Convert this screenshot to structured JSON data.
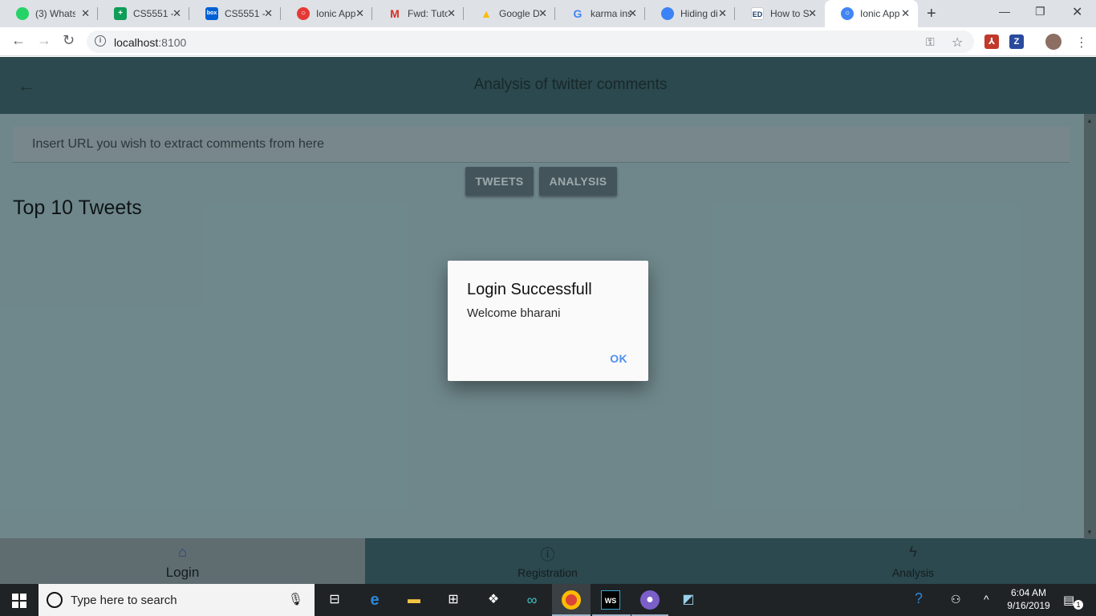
{
  "browser": {
    "tabs": [
      {
        "label": "(3) Whats",
        "icon": "whatsapp-icon",
        "color": "#25d366"
      },
      {
        "label": "CS5551 -",
        "icon": "sheets-icon",
        "color": "#0f9d58"
      },
      {
        "label": "CS5551 -",
        "icon": "box-icon",
        "color": "#0061d5"
      },
      {
        "label": "Ionic App",
        "icon": "ionic-icon",
        "color": "#e53935"
      },
      {
        "label": "Fwd: Tuto",
        "icon": "gmail-icon",
        "color": "#d93025"
      },
      {
        "label": "Google D",
        "icon": "drive-icon",
        "color": "#fbbc04"
      },
      {
        "label": "karma ins",
        "icon": "google-icon",
        "color": "#4285f4"
      },
      {
        "label": "Hiding di",
        "icon": "angular-icon",
        "color": "#3b82f6"
      },
      {
        "label": "How to S",
        "icon": "ed-icon",
        "color": "#1a3d6d"
      },
      {
        "label": "Ionic App",
        "icon": "chrome-tab-icon",
        "color": "#4285f4"
      }
    ],
    "url_host": "localhost",
    "url_port": ":8100"
  },
  "app": {
    "title": "Analysis of twitter comments",
    "url_placeholder": "Insert URL you wish to extract comments from here",
    "buttons": {
      "tweets": "TWEETS",
      "analysis": "ANALYSIS"
    },
    "section_title": "Top 10 Tweets",
    "tabbar": [
      {
        "label": "Login",
        "icon": "home-icon"
      },
      {
        "label": "Registration",
        "icon": "info-icon"
      },
      {
        "label": "Analysis",
        "icon": "flash-icon"
      }
    ]
  },
  "alert": {
    "title": "Login Successfull",
    "message": "Welcome bharani",
    "ok": "OK"
  },
  "taskbar": {
    "search_placeholder": "Type here to search",
    "time": "6:04 AM",
    "date": "9/16/2019",
    "notification_count": "1"
  },
  "colors": {
    "header": "#2f5256",
    "content": "#7f9a9e",
    "alert_ok": "#4f8ff0"
  }
}
